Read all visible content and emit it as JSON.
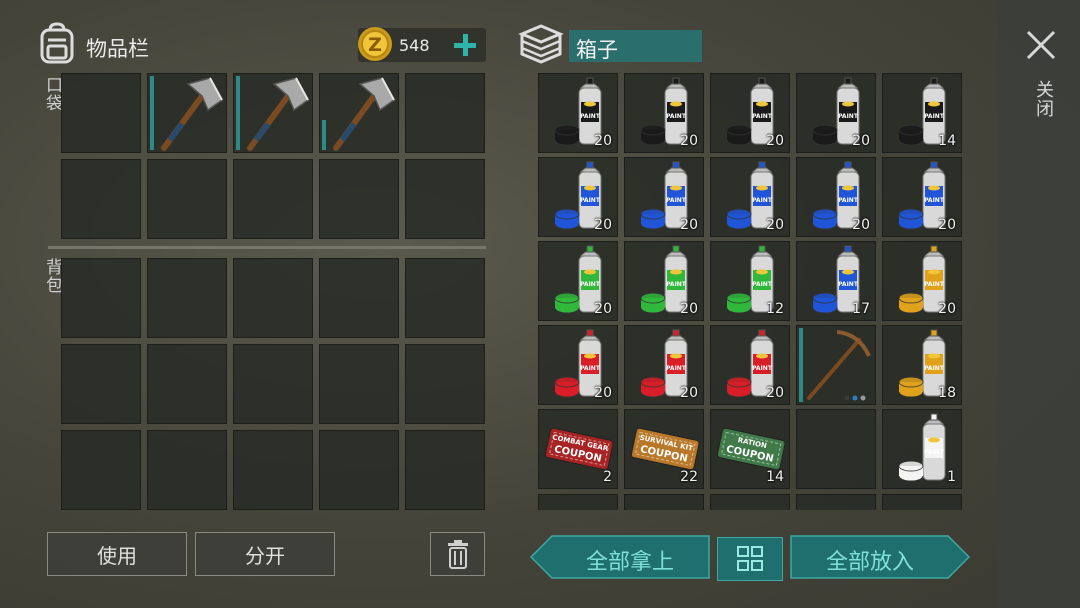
{
  "inventory": {
    "title": "物品栏",
    "coins": "548",
    "pocket_label": "口袋",
    "backpack_label": "背包",
    "use_label": "使用",
    "split_label": "分开"
  },
  "box": {
    "title": "箱子",
    "close_label": "关闭",
    "take_all_label": "全部拿上",
    "put_all_label": "全部放入"
  },
  "box_items": [
    {
      "type": "spray",
      "color": "#1a1a1a",
      "count": "20"
    },
    {
      "type": "spray",
      "color": "#1a1a1a",
      "count": "20"
    },
    {
      "type": "spray",
      "color": "#1a1a1a",
      "count": "20"
    },
    {
      "type": "spray",
      "color": "#1a1a1a",
      "count": "20"
    },
    {
      "type": "spray",
      "color": "#1a1a1a",
      "count": "14"
    },
    {
      "type": "spray",
      "color": "#1f55d6",
      "count": "20"
    },
    {
      "type": "spray",
      "color": "#1f55d6",
      "count": "20"
    },
    {
      "type": "spray",
      "color": "#1f55d6",
      "count": "20"
    },
    {
      "type": "spray",
      "color": "#1f55d6",
      "count": "20"
    },
    {
      "type": "spray",
      "color": "#1f55d6",
      "count": "20"
    },
    {
      "type": "spray",
      "color": "#2fb83a",
      "count": "20"
    },
    {
      "type": "spray",
      "color": "#2fb83a",
      "count": "20"
    },
    {
      "type": "spray",
      "color": "#2fb83a",
      "count": "12"
    },
    {
      "type": "spray",
      "color": "#1f55d6",
      "count": "17"
    },
    {
      "type": "spray",
      "color": "#e0a21a",
      "count": "20"
    },
    {
      "type": "spray",
      "color": "#d81e26",
      "count": "20"
    },
    {
      "type": "spray",
      "color": "#d81e26",
      "count": "20"
    },
    {
      "type": "spray",
      "color": "#d81e26",
      "count": "20"
    },
    {
      "type": "pickaxe",
      "count": ""
    },
    {
      "type": "spray",
      "color": "#e0a21a",
      "count": "18"
    },
    {
      "type": "coupon",
      "color": "#a82424",
      "line1": "COMBAT GEAR",
      "line2": "COUPON",
      "count": "2"
    },
    {
      "type": "coupon",
      "color": "#b9772a",
      "line1": "SURVIVAL KIT",
      "line2": "COUPON",
      "count": "22"
    },
    {
      "type": "coupon",
      "color": "#3f7a48",
      "line1": "RATION",
      "line2": "COUPON",
      "count": "14"
    },
    {
      "type": "empty",
      "count": ""
    },
    {
      "type": "spray",
      "color": "#f4f4f4",
      "count": "1"
    }
  ],
  "icons": {
    "backpack": "backpack-icon",
    "coin": "coin-icon",
    "add": "plus-icon",
    "box": "crate-icon",
    "close": "close-icon",
    "trash": "trash-icon",
    "sort": "grid-sort-icon",
    "hatchet": "hatchet-icon",
    "spray": "spray-can-icon",
    "coupon": "coupon-icon",
    "pickaxe": "pickaxe-icon"
  }
}
